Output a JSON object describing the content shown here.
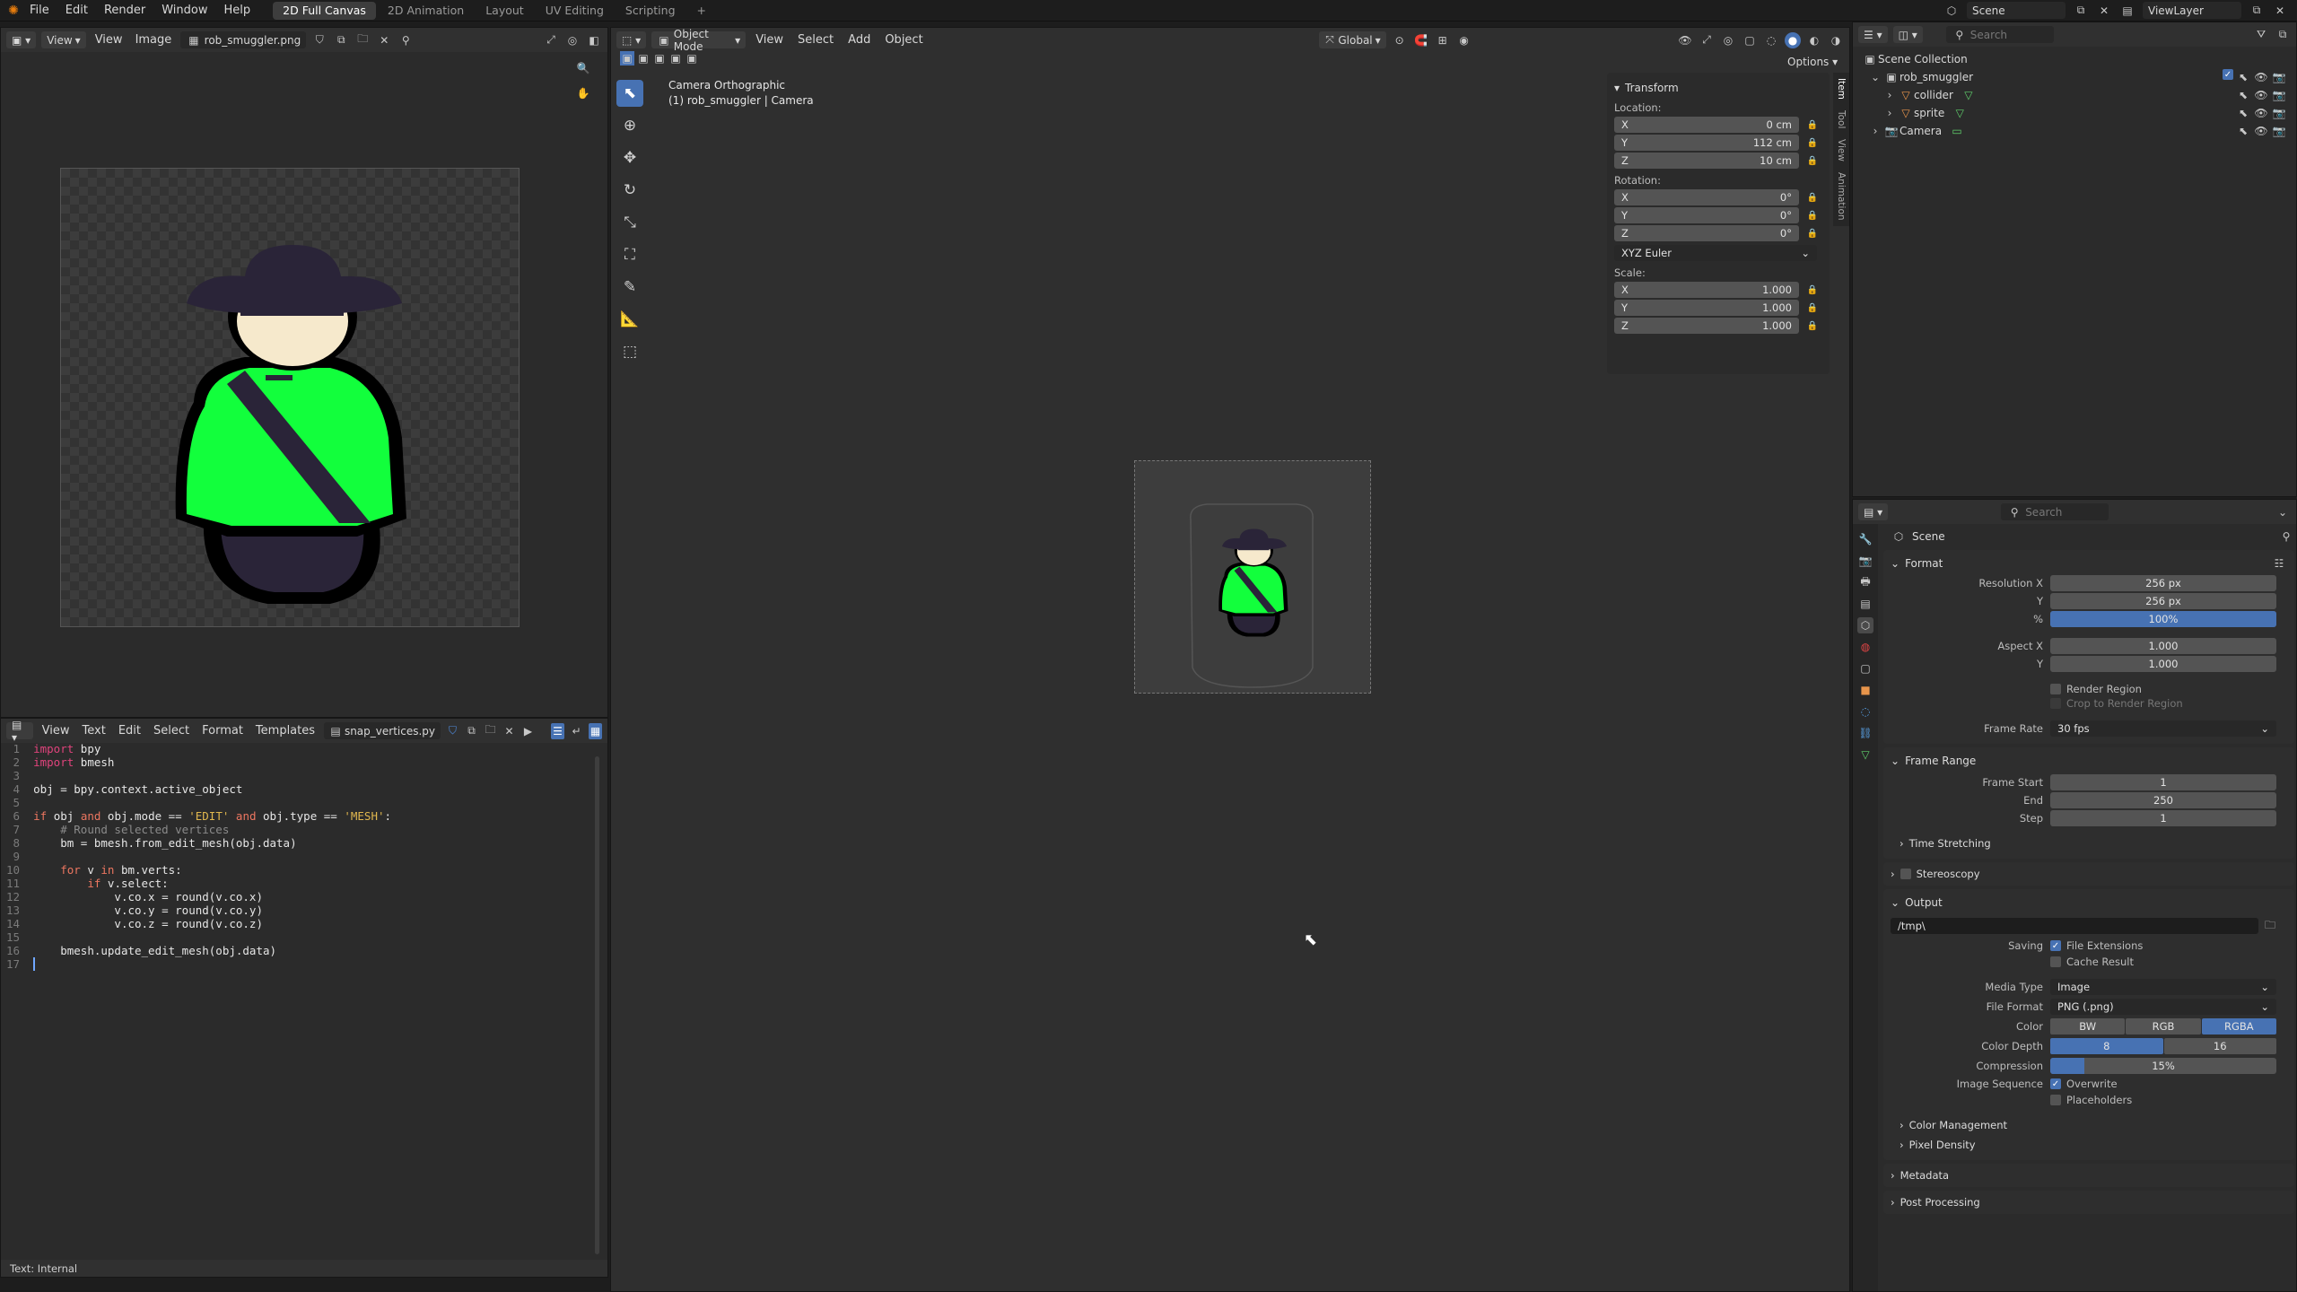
{
  "topbar": {
    "menus": [
      "File",
      "Edit",
      "Render",
      "Window",
      "Help"
    ],
    "workspaces": [
      "2D Full Canvas",
      "2D Animation",
      "Layout",
      "UV Editing",
      "Scripting"
    ],
    "active_workspace": "2D Full Canvas",
    "scene_name": "Scene",
    "view_layer": "ViewLayer"
  },
  "image_editor": {
    "menus": [
      "View",
      "View",
      "Image"
    ],
    "image_name": "rob_smuggler.png"
  },
  "text_editor": {
    "menus": [
      "View",
      "Text",
      "Edit",
      "Select",
      "Format",
      "Templates"
    ],
    "file_name": "snap_vertices.py",
    "status": "Text: Internal",
    "lines": [
      [
        {
          "t": "import",
          "c": "kw"
        },
        {
          "t": " bpy",
          "c": "txt"
        }
      ],
      [
        {
          "t": "import",
          "c": "kw"
        },
        {
          "t": " bmesh",
          "c": "txt"
        }
      ],
      [],
      [
        {
          "t": "obj = bpy.context.active_object",
          "c": "txt"
        }
      ],
      [],
      [
        {
          "t": "if",
          "c": "kw2"
        },
        {
          "t": " obj ",
          "c": "txt"
        },
        {
          "t": "and",
          "c": "kw2"
        },
        {
          "t": " obj.mode == ",
          "c": "txt"
        },
        {
          "t": "'EDIT'",
          "c": "str"
        },
        {
          "t": " ",
          "c": "txt"
        },
        {
          "t": "and",
          "c": "kw2"
        },
        {
          "t": " obj.type == ",
          "c": "txt"
        },
        {
          "t": "'MESH'",
          "c": "str"
        },
        {
          "t": ":",
          "c": "txt"
        }
      ],
      [
        {
          "t": "    # Round selected vertices",
          "c": "cmt"
        }
      ],
      [
        {
          "t": "    bm = bmesh.from_edit_mesh(obj.data)",
          "c": "txt"
        }
      ],
      [],
      [
        {
          "t": "    ",
          "c": "txt"
        },
        {
          "t": "for",
          "c": "kw2"
        },
        {
          "t": " v ",
          "c": "txt"
        },
        {
          "t": "in",
          "c": "kw2"
        },
        {
          "t": " bm.verts:",
          "c": "txt"
        }
      ],
      [
        {
          "t": "        ",
          "c": "txt"
        },
        {
          "t": "if",
          "c": "kw2"
        },
        {
          "t": " v.select:",
          "c": "txt"
        }
      ],
      [
        {
          "t": "            v.co.x = round(v.co.x)",
          "c": "txt"
        }
      ],
      [
        {
          "t": "            v.co.y = round(v.co.y)",
          "c": "txt"
        }
      ],
      [
        {
          "t": "            v.co.z = round(v.co.z)",
          "c": "txt"
        }
      ],
      [],
      [
        {
          "t": "    bmesh.update_edit_mesh(obj.data)",
          "c": "txt"
        }
      ],
      []
    ]
  },
  "viewport": {
    "mode": "Object Mode",
    "menus": [
      "View",
      "Select",
      "Add",
      "Object"
    ],
    "orientation": "Global",
    "options_label": "Options",
    "camera_title": "Camera Orthographic",
    "camera_subtitle": "(1) rob_smuggler | Camera",
    "side_tabs": [
      "Item",
      "Tool",
      "View",
      "Animation"
    ]
  },
  "transform": {
    "title": "Transform",
    "location_label": "Location:",
    "location": [
      {
        "axis": "X",
        "value": "0 cm"
      },
      {
        "axis": "Y",
        "value": "112 cm"
      },
      {
        "axis": "Z",
        "value": "10 cm"
      }
    ],
    "rotation_label": "Rotation:",
    "rotation": [
      {
        "axis": "X",
        "value": "0°"
      },
      {
        "axis": "Y",
        "value": "0°"
      },
      {
        "axis": "Z",
        "value": "0°"
      }
    ],
    "rotation_mode": "XYZ Euler",
    "scale_label": "Scale:",
    "scale": [
      {
        "axis": "X",
        "value": "1.000"
      },
      {
        "axis": "Y",
        "value": "1.000"
      },
      {
        "axis": "Z",
        "value": "1.000"
      }
    ]
  },
  "outliner": {
    "search_placeholder": "Search",
    "root": "Scene Collection",
    "items": [
      {
        "name": "rob_smuggler",
        "level": 1
      },
      {
        "name": "collider",
        "level": 2
      },
      {
        "name": "sprite",
        "level": 2
      },
      {
        "name": "Camera",
        "level": 1
      }
    ]
  },
  "properties": {
    "search_placeholder": "Search",
    "context": "Scene",
    "format": {
      "title": "Format",
      "res_x_label": "Resolution X",
      "res_x": "256 px",
      "res_y_label": "Y",
      "res_y": "256 px",
      "res_pct_label": "%",
      "res_pct": "100%",
      "res_pct_value": 1.0,
      "aspect_x_label": "Aspect X",
      "aspect_x": "1.000",
      "aspect_y_label": "Y",
      "aspect_y": "1.000",
      "render_region": "Render Region",
      "crop_region": "Crop to Render Region",
      "frame_rate_label": "Frame Rate",
      "frame_rate": "30 fps"
    },
    "frame_range": {
      "title": "Frame Range",
      "start_label": "Frame Start",
      "start": "1",
      "end_label": "End",
      "end": "250",
      "step_label": "Step",
      "step": "1",
      "time_stretching": "Time Stretching"
    },
    "stereoscopy": "Stereoscopy",
    "output": {
      "title": "Output",
      "path": "/tmp\\",
      "saving_label": "Saving",
      "file_extensions": "File Extensions",
      "cache_result": "Cache Result",
      "media_type_label": "Media Type",
      "media_type": "Image",
      "file_format_label": "File Format",
      "file_format": "PNG (.png)",
      "color_label": "Color",
      "color_options": [
        "BW",
        "RGB",
        "RGBA"
      ],
      "color_selected": "RGBA",
      "depth_label": "Color Depth",
      "depth_options": [
        "8",
        "16"
      ],
      "depth_selected": "8",
      "compression_label": "Compression",
      "compression": "15%",
      "compression_value": 0.15,
      "image_sequence_label": "Image Sequence",
      "overwrite": "Overwrite",
      "placeholders": "Placeholders",
      "color_management": "Color Management",
      "pixel_density": "Pixel Density"
    },
    "metadata": "Metadata",
    "post_processing": "Post Processing"
  },
  "colors": {
    "accent": "#4772b3",
    "sprite_green": "#12ff3c",
    "sprite_dark": "#2a2438",
    "sprite_skin": "#f6e9cc"
  }
}
